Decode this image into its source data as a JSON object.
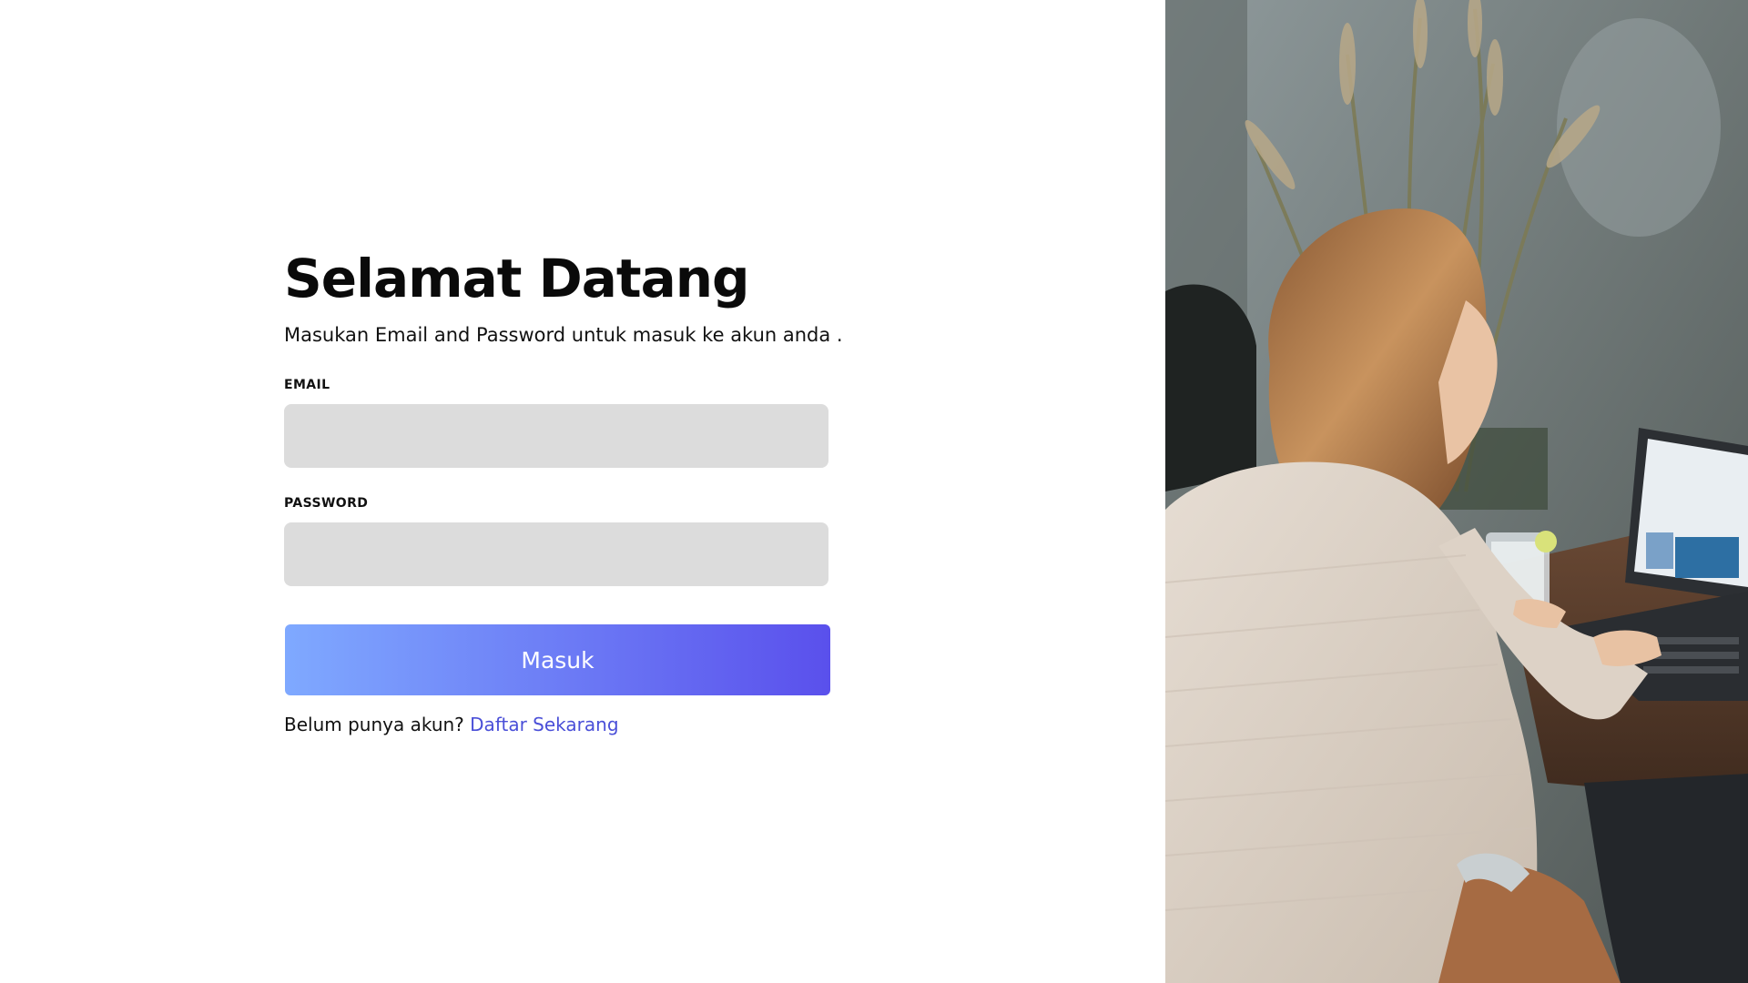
{
  "login": {
    "title": "Selamat Datang",
    "subtitle": "Masukan Email and Password untuk masuk ke akun anda .",
    "email_label": "EMAIL",
    "email_value": "",
    "password_label": "PASSWORD",
    "password_value": "",
    "submit_label": "Masuk",
    "signup_prompt": "Belum punya akun?",
    "signup_link": "Daftar Sekarang"
  },
  "colors": {
    "button_gradient_start": "#7fa9ff",
    "button_gradient_end": "#5a50ec",
    "link": "#4a4fd8",
    "input_background": "#dcdcdc"
  },
  "hero_image": {
    "icon": "photo-woman-laptop"
  }
}
